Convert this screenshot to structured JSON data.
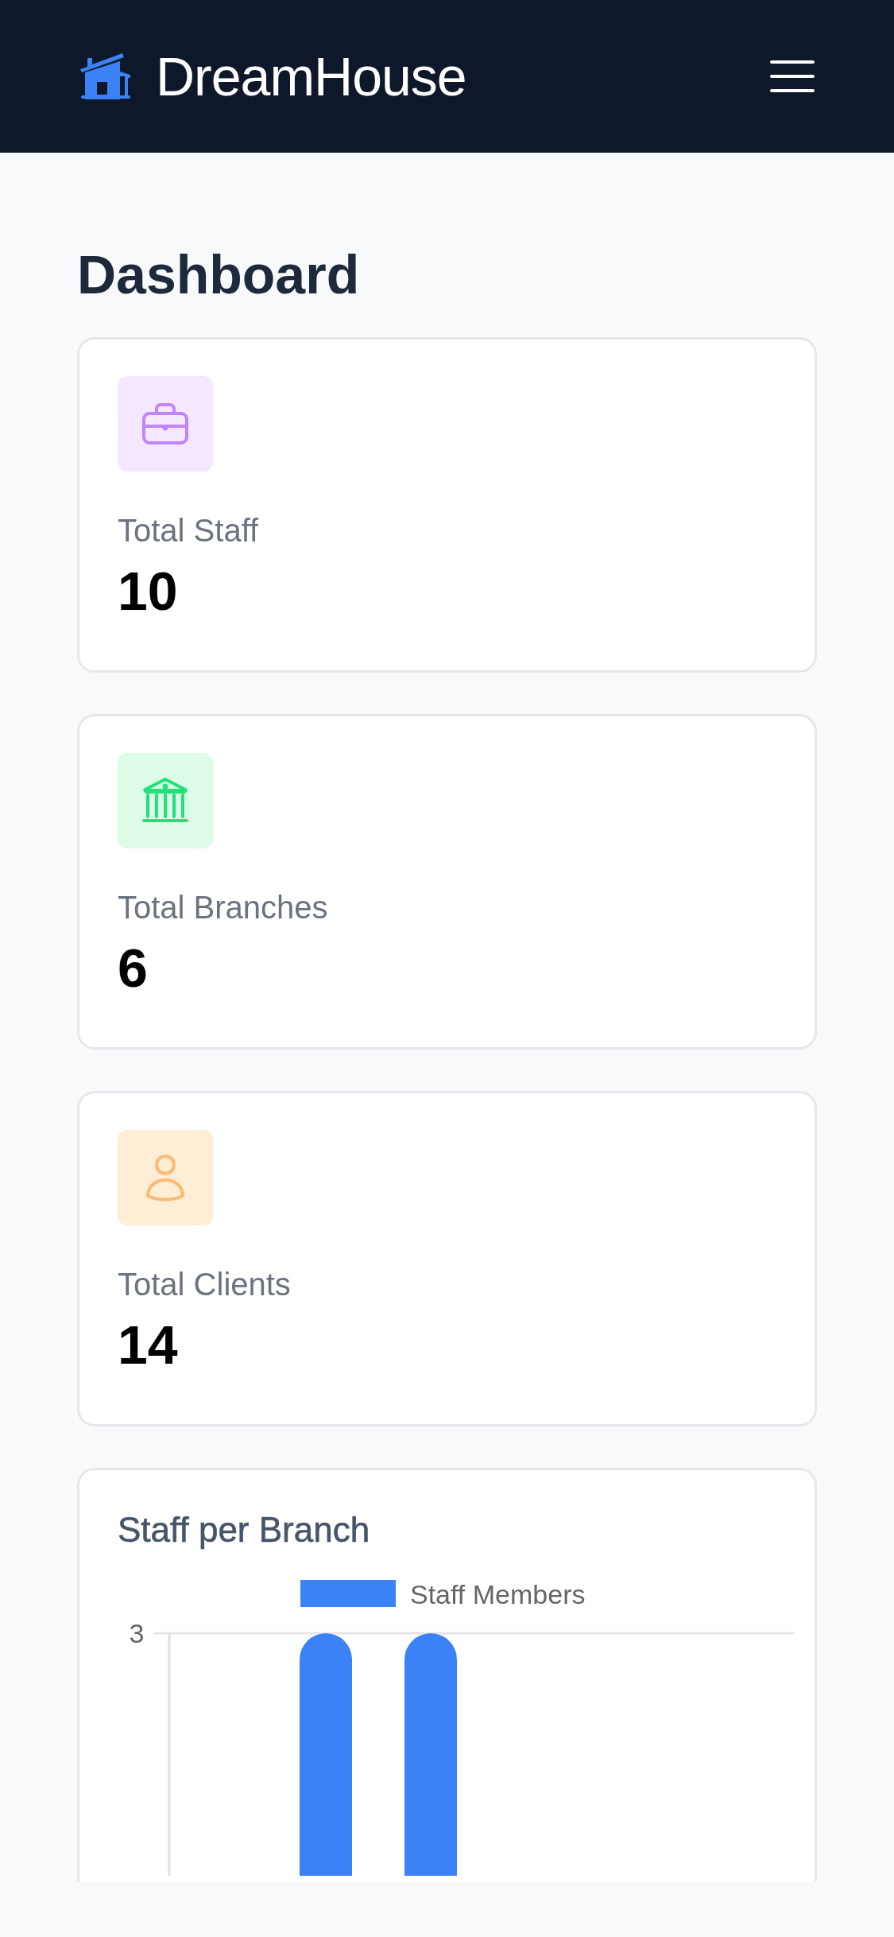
{
  "header": {
    "brand": "DreamHouse"
  },
  "page_title": "Dashboard",
  "stats": [
    {
      "kind": "briefcase",
      "label": "Total Staff",
      "value": "10"
    },
    {
      "kind": "bank",
      "label": "Total Branches",
      "value": "6"
    },
    {
      "kind": "person",
      "label": "Total Clients",
      "value": "14"
    }
  ],
  "chart_card": {
    "title": "Staff per Branch",
    "legend": "Staff Members",
    "axis_tick": "3"
  }
}
